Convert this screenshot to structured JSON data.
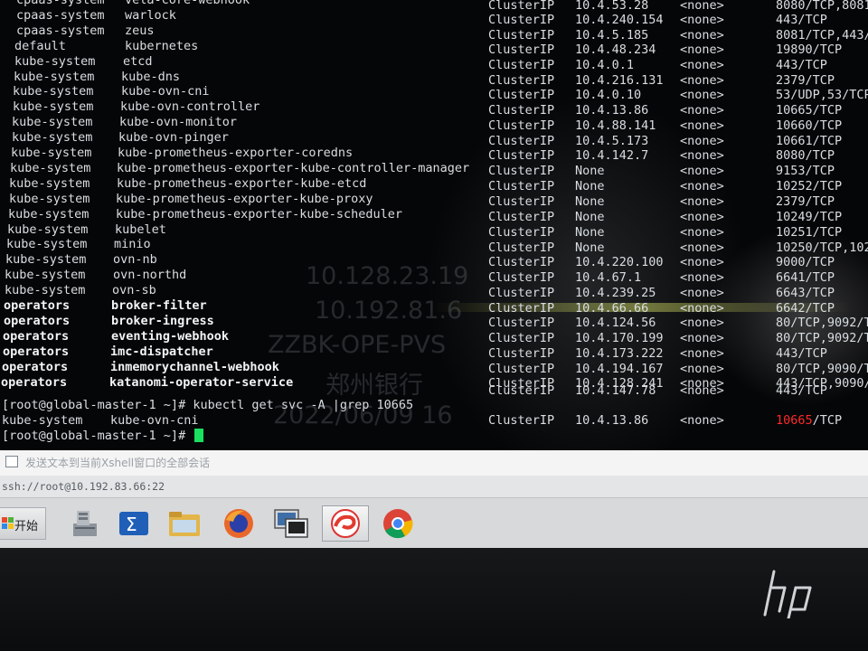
{
  "terminal": {
    "rows": [
      {
        "ns": "cpaas-system",
        "name": "vela-core-webhook",
        "type": "ClusterIP",
        "ip": "10.4.53.28",
        "ext": "<none>",
        "port": "8080/TCP,8081/TC",
        "bold": false
      },
      {
        "ns": "cpaas-system",
        "name": "warlock",
        "type": "ClusterIP",
        "ip": "10.4.240.154",
        "ext": "<none>",
        "port": "443/TCP",
        "bold": false
      },
      {
        "ns": "cpaas-system",
        "name": "zeus",
        "type": "ClusterIP",
        "ip": "10.4.5.185",
        "ext": "<none>",
        "port": "8081/TCP,443/TC",
        "bold": false
      },
      {
        "ns": "default",
        "name": "kubernetes",
        "type": "ClusterIP",
        "ip": "10.4.48.234",
        "ext": "<none>",
        "port": "19890/TCP",
        "bold": false
      },
      {
        "ns": "kube-system",
        "name": "etcd",
        "type": "ClusterIP",
        "ip": "10.4.0.1",
        "ext": "<none>",
        "port": "443/TCP",
        "bold": false
      },
      {
        "ns": "kube-system",
        "name": "kube-dns",
        "type": "ClusterIP",
        "ip": "10.4.216.131",
        "ext": "<none>",
        "port": "2379/TCP",
        "bold": false
      },
      {
        "ns": "kube-system",
        "name": "kube-ovn-cni",
        "type": "ClusterIP",
        "ip": "10.4.0.10",
        "ext": "<none>",
        "port": "53/UDP,53/TCP,9",
        "bold": false
      },
      {
        "ns": "kube-system",
        "name": "kube-ovn-controller",
        "type": "ClusterIP",
        "ip": "10.4.13.86",
        "ext": "<none>",
        "port": "10665/TCP",
        "bold": false
      },
      {
        "ns": "kube-system",
        "name": "kube-ovn-monitor",
        "type": "ClusterIP",
        "ip": "10.4.88.141",
        "ext": "<none>",
        "port": "10660/TCP",
        "bold": false
      },
      {
        "ns": "kube-system",
        "name": "kube-ovn-pinger",
        "type": "ClusterIP",
        "ip": "10.4.5.173",
        "ext": "<none>",
        "port": "10661/TCP",
        "bold": false
      },
      {
        "ns": "kube-system",
        "name": "kube-prometheus-exporter-coredns",
        "type": "ClusterIP",
        "ip": "10.4.142.7",
        "ext": "<none>",
        "port": "8080/TCP",
        "bold": false
      },
      {
        "ns": "kube-system",
        "name": "kube-prometheus-exporter-kube-controller-manager",
        "type": "ClusterIP",
        "ip": "None",
        "ext": "<none>",
        "port": "9153/TCP",
        "bold": false
      },
      {
        "ns": "kube-system",
        "name": "kube-prometheus-exporter-kube-etcd",
        "type": "ClusterIP",
        "ip": "None",
        "ext": "<none>",
        "port": "10252/TCP",
        "bold": false
      },
      {
        "ns": "kube-system",
        "name": "kube-prometheus-exporter-kube-proxy",
        "type": "ClusterIP",
        "ip": "None",
        "ext": "<none>",
        "port": "2379/TCP",
        "bold": false
      },
      {
        "ns": "kube-system",
        "name": "kube-prometheus-exporter-kube-scheduler",
        "type": "ClusterIP",
        "ip": "None",
        "ext": "<none>",
        "port": "10249/TCP",
        "bold": false
      },
      {
        "ns": "kube-system",
        "name": "kubelet",
        "type": "ClusterIP",
        "ip": "None",
        "ext": "<none>",
        "port": "10251/TCP",
        "bold": false
      },
      {
        "ns": "kube-system",
        "name": "minio",
        "type": "ClusterIP",
        "ip": "None",
        "ext": "<none>",
        "port": "10250/TCP,10255",
        "bold": false
      },
      {
        "ns": "kube-system",
        "name": "ovn-nb",
        "type": "ClusterIP",
        "ip": "10.4.220.100",
        "ext": "<none>",
        "port": "9000/TCP",
        "bold": false
      },
      {
        "ns": "kube-system",
        "name": "ovn-northd",
        "type": "ClusterIP",
        "ip": "10.4.67.1",
        "ext": "<none>",
        "port": "6641/TCP",
        "bold": false
      },
      {
        "ns": "kube-system",
        "name": "ovn-sb",
        "type": "ClusterIP",
        "ip": "10.4.239.25",
        "ext": "<none>",
        "port": "6643/TCP",
        "bold": false
      },
      {
        "ns": "operators",
        "name": "broker-filter",
        "type": "ClusterIP",
        "ip": "10.4.66.66",
        "ext": "<none>",
        "port": "6642/TCP",
        "bold": true
      },
      {
        "ns": "operators",
        "name": "broker-ingress",
        "type": "ClusterIP",
        "ip": "10.4.124.56",
        "ext": "<none>",
        "port": "80/TCP,9092/TC",
        "bold": true
      },
      {
        "ns": "operators",
        "name": "eventing-webhook",
        "type": "ClusterIP",
        "ip": "10.4.170.199",
        "ext": "<none>",
        "port": "80/TCP,9092/TC",
        "bold": true
      },
      {
        "ns": "operators",
        "name": "imc-dispatcher",
        "type": "ClusterIP",
        "ip": "10.4.173.222",
        "ext": "<none>",
        "port": "443/TCP",
        "bold": true
      },
      {
        "ns": "operators",
        "name": "inmemorychannel-webhook",
        "type": "ClusterIP",
        "ip": "10.4.194.167",
        "ext": "<none>",
        "port": "80/TCP,9090/TC",
        "bold": true
      },
      {
        "ns": "operators",
        "name": "katanomi-operator-service",
        "type": "ClusterIP",
        "ip": "10.4.128.241",
        "ext": "<none>",
        "port": "443/TCP,9090/TC",
        "bold": true
      }
    ],
    "extra_right": {
      "type": "ClusterIP",
      "ip": "10.4.147.78",
      "ext": "<none>",
      "port": "443/TCP"
    },
    "command_line": "[root@global-master-1 ~]# kubectl get svc -A |grep 10665",
    "result": {
      "ns": "kube-system",
      "name": "kube-ovn-cni",
      "type": "ClusterIP",
      "ip": "10.4.13.86",
      "ext": "<none>",
      "port_highlight": "10665",
      "port_rest": "/TCP"
    },
    "prompt": "[root@global-master-1 ~]#",
    "watermark": [
      "10.128.23.19",
      "10.192.81.6",
      "ZZBK-OPE-PVS",
      "郑州银行",
      "2022/06/09 16"
    ]
  },
  "xshell": {
    "compose_text": "发送文本到当前Xshell窗口的全部会话",
    "session_text": "ssh://root@10.192.83.66:22"
  },
  "taskbar": {
    "start_label": "开始",
    "icons": [
      "network-tool-icon",
      "powershell-icon",
      "file-explorer-icon",
      "firefox-icon",
      "remote-desktop-icon",
      "xshell-icon",
      "chrome-icon"
    ]
  },
  "colors": {
    "cursor": "#19e05e",
    "highlight": "#ff2a2a"
  }
}
